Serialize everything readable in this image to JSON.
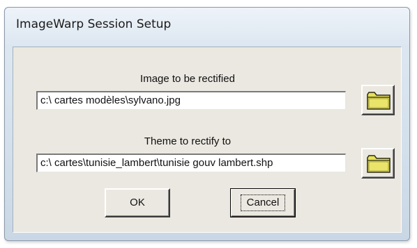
{
  "window": {
    "title": "ImageWarp Session Setup"
  },
  "image_section": {
    "label": "Image to be rectified",
    "value": "c:\\ cartes modèles\\sylvano.jpg",
    "browse_icon": "folder-icon"
  },
  "theme_section": {
    "label": "Theme to rectify to",
    "value": "c:\\ cartes\\tunisie_lambert\\tunisie gouv lambert.shp",
    "browse_icon": "folder-icon"
  },
  "buttons": {
    "ok_label": "OK",
    "cancel_label": "Cancel"
  },
  "colors": {
    "folder_fill": "#e6e05a",
    "folder_outline": "#2a2a10",
    "client_background": "#ebe8e1"
  }
}
